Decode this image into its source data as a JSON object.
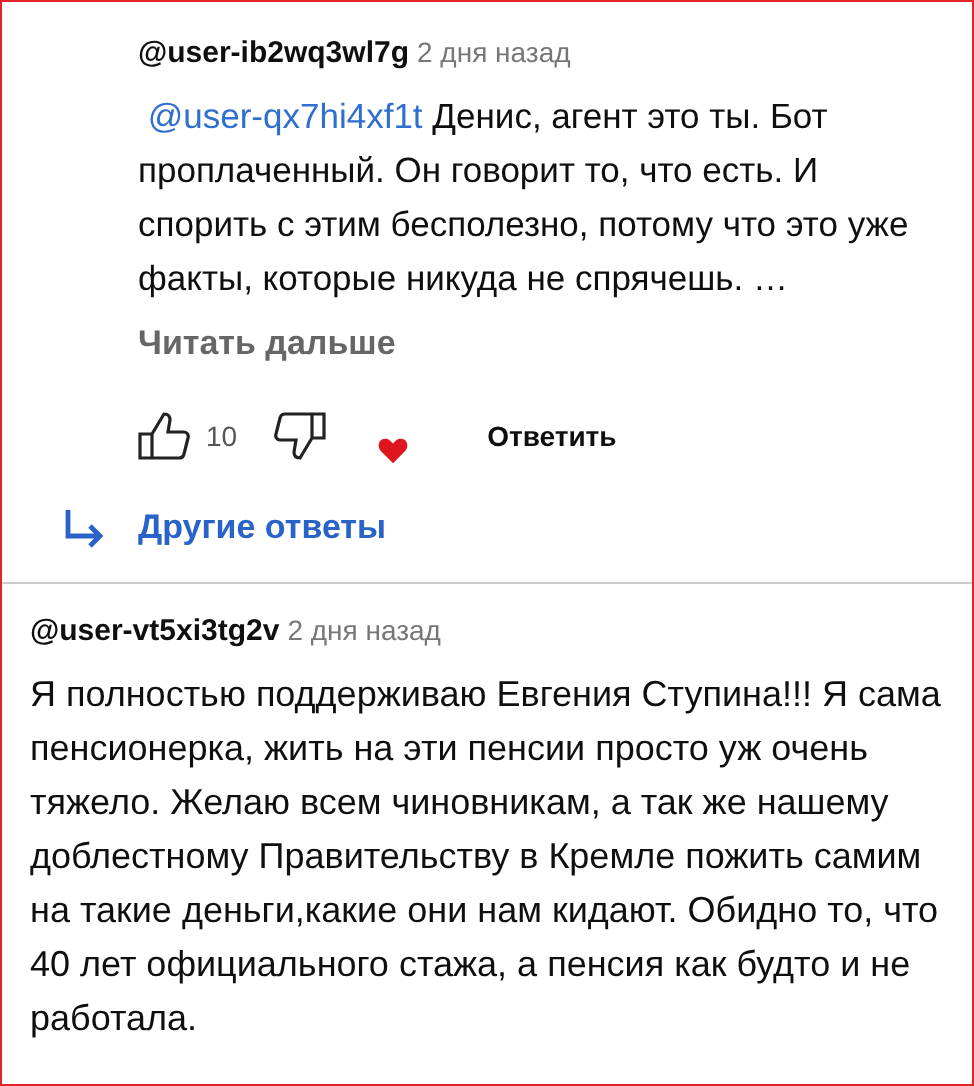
{
  "comments": [
    {
      "kind": "reply",
      "author": "@user-ib2wq3wl7g",
      "time": "2 дня назад",
      "mention": "@user-qx7hi4xf1t",
      "text": "Денис, агент это ты. Бот проплаченный. Он говорит то, что есть. И спорить с этим бесполезно, потому что это уже факты, которые никуда не спрячешь. …",
      "read_more": "Читать дальше",
      "likes": "10",
      "reply_button": "Ответить"
    },
    {
      "kind": "more_replies",
      "label": "Другие ответы"
    },
    {
      "kind": "comment",
      "author": "@user-vt5xi3tg2v",
      "time": "2 дня назад",
      "text": "Я полностью поддерживаю Евгения Ступина!!! Я сама пенсионерка, жить на эти пенсии просто уж очень тяжело. Желаю всем чиновникам, а так же нашему доблестному Правительству в Кремле пожить самим на такие деньги,какие они нам кидают. Обидно то, что 40 лет официального стажа, а пенсия как будто и не работала."
    }
  ]
}
